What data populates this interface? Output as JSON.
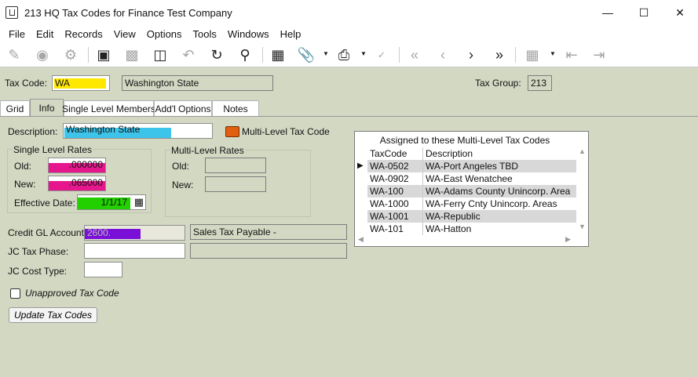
{
  "window": {
    "title": "213 HQ Tax Codes for Finance Test Company"
  },
  "menu": [
    "File",
    "Edit",
    "Records",
    "View",
    "Options",
    "Tools",
    "Windows",
    "Help"
  ],
  "header": {
    "tax_code_label": "Tax Code:",
    "tax_code_value": "WA",
    "tax_code_desc": "Washington State",
    "tax_group_label": "Tax Group:",
    "tax_group_value": "213"
  },
  "tabs": [
    "Grid",
    "Info",
    "Single Level Members",
    "Add'l Options",
    "Notes"
  ],
  "info": {
    "description_label": "Description:",
    "description_value": "Washington State",
    "multilevel_label": "Multi-Level Tax Code",
    "single_level_title": "Single Level Rates",
    "old_label": "Old:",
    "old_value": ".000000",
    "new_label": "New:",
    "new_value": ".065000",
    "effective_label": "Effective Date:",
    "effective_value": "1/1/17",
    "multi_level_title": "Multi-Level Rates",
    "ml_old_label": "Old:",
    "ml_new_label": "New:",
    "credit_gl_label": "Credit GL Account:",
    "credit_gl_value": "2600.",
    "credit_gl_desc": "Sales Tax Payable -",
    "jc_phase_label": "JC Tax Phase:",
    "jc_cost_label": "JC Cost Type:",
    "unapproved_label": "Unapproved Tax Code",
    "update_button": "Update Tax Codes"
  },
  "assigned": {
    "title": "Assigned to these Multi-Level Tax Codes",
    "col_taxcode": "TaxCode",
    "col_description": "Description",
    "rows": [
      {
        "code": "WA-0502",
        "desc": "WA-Port Angeles TBD"
      },
      {
        "code": "WA-0902",
        "desc": "WA-East Wenatchee"
      },
      {
        "code": "WA-100",
        "desc": "WA-Adams County Unincorp. Area"
      },
      {
        "code": "WA-1000",
        "desc": "WA-Ferry Cnty Unincorp. Areas"
      },
      {
        "code": "WA-1001",
        "desc": "WA-Republic"
      },
      {
        "code": "WA-101",
        "desc": "WA-Hatton"
      }
    ]
  },
  "colors": {
    "yellow": "#ffe800",
    "cyan": "#3cc4ea",
    "magenta": "#e6168c",
    "green": "#22d000",
    "purple": "#7a10d8",
    "orange": "#e06010"
  }
}
